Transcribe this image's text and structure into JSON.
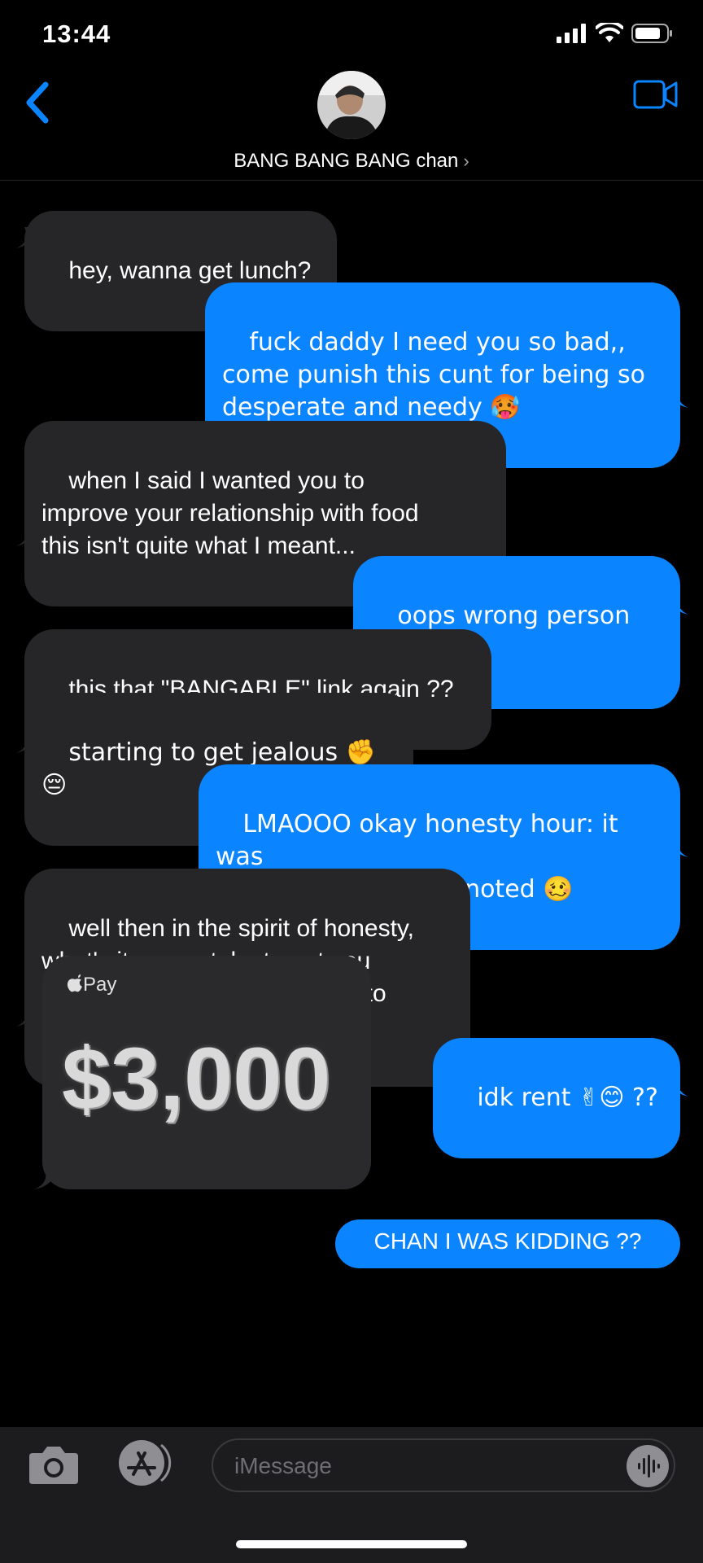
{
  "status_bar": {
    "time": "13:44"
  },
  "header": {
    "contact_name": "BANG BANG BANG chan",
    "chevron": "›"
  },
  "messages": [
    {
      "from": "them",
      "text": "hey, wanna get lunch?"
    },
    {
      "from": "me",
      "text": "fuck daddy I need you so bad,,\ncome punish this cunt for being so\ndesperate and needy 🥵"
    },
    {
      "from": "them",
      "text": "when I said I wanted you to\nimprove your relationship with food\nthis isn't quite what I meant..."
    },
    {
      "from": "me",
      "text": "oops wrong person 😬"
    },
    {
      "from": "them",
      "text": "this that \"BANGABLE\" link again ??"
    },
    {
      "from": "them",
      "text": "starting to get jealous ✊😔"
    },
    {
      "from": "me",
      "text": "LMAOOO okay honesty hour: it was\na tiktok prank ,, but noted 🥴"
    },
    {
      "from": "them",
      "text": "well then in the spirit of honesty,\nwhat's it gonna take to get you\nneedy and desperate enough to\ncall me daddy for real?"
    },
    {
      "from": "me",
      "text": "idk rent ✌😊 ??"
    },
    {
      "from": "me",
      "text": "CHAN I WAS KIDDING ??"
    }
  ],
  "apple_pay": {
    "label": "Pay",
    "amount": "$3,000"
  },
  "composer": {
    "placeholder": "iMessage"
  },
  "colors": {
    "outgoing": "#0a84ff",
    "incoming": "#262628",
    "accent": "#0a84ff"
  }
}
